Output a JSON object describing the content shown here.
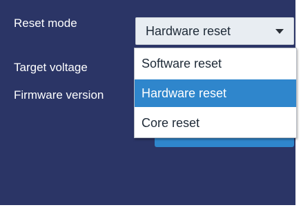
{
  "fields": {
    "reset_mode_label": "Reset mode",
    "target_voltage_label": "Target voltage",
    "firmware_version_label": "Firmware version"
  },
  "reset_mode_select": {
    "selected": "Hardware reset",
    "icon": "chevron-down-icon"
  },
  "dropdown": {
    "options": [
      {
        "label": "Software reset",
        "selected": false
      },
      {
        "label": "Hardware reset",
        "selected": true
      },
      {
        "label": "Core reset",
        "selected": false
      }
    ]
  },
  "colors": {
    "panel_bg": "#2b3566",
    "accent": "#2f86cc"
  }
}
